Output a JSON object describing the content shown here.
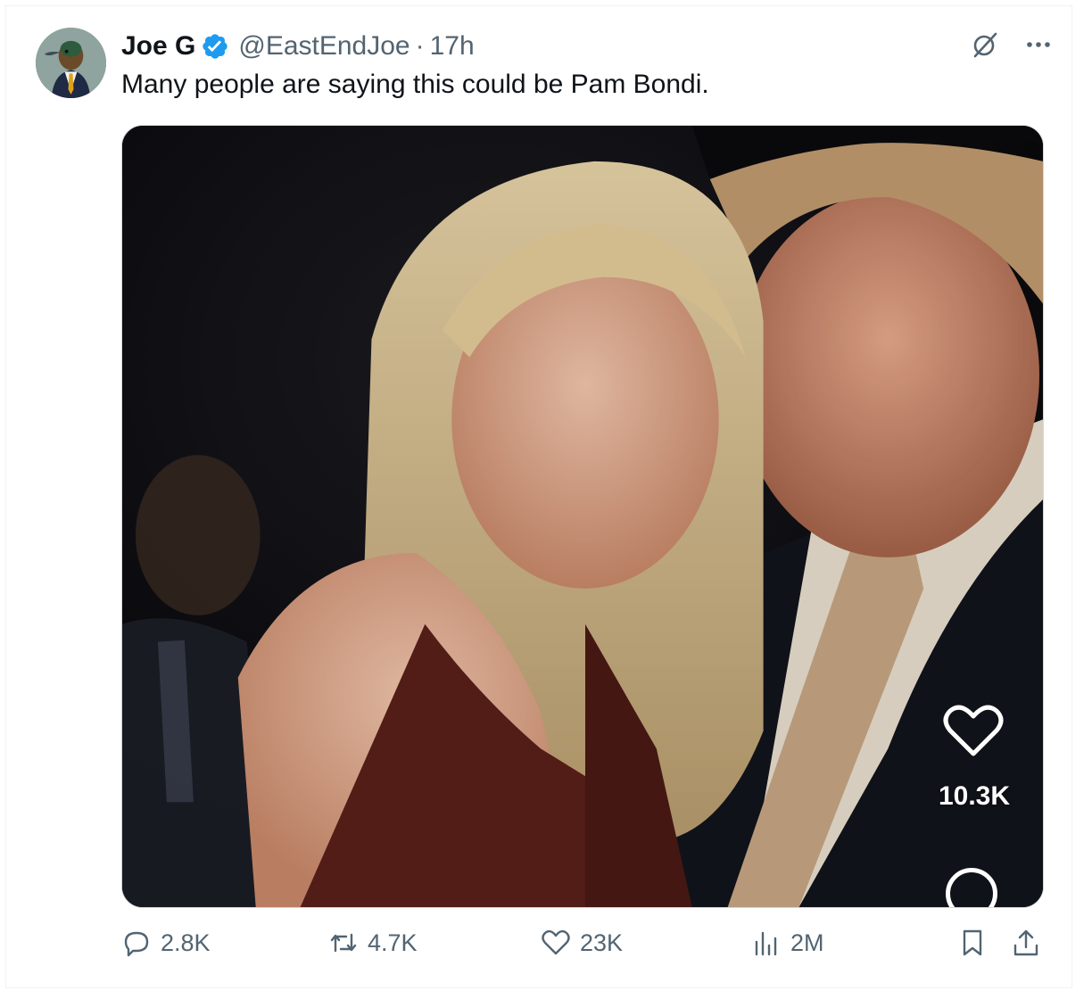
{
  "tweet": {
    "author_name": "Joe G",
    "handle": "@EastEndJoe",
    "separator": "·",
    "time": "17h",
    "text": "Many people are saying this could be Pam Bondi.",
    "verified": true
  },
  "media": {
    "overlay_like_count": "10.3K"
  },
  "actions": {
    "replies": "2.8K",
    "reposts": "4.7K",
    "likes": "23K",
    "views": "2M"
  },
  "colors": {
    "muted": "#536471",
    "verified_blue": "#1d9bf0",
    "border": "#eff3f4"
  },
  "icons": [
    "grok-icon",
    "more-icon",
    "verified-icon",
    "reply-icon",
    "retweet-icon",
    "like-icon",
    "views-icon",
    "bookmark-icon",
    "share-icon"
  ]
}
